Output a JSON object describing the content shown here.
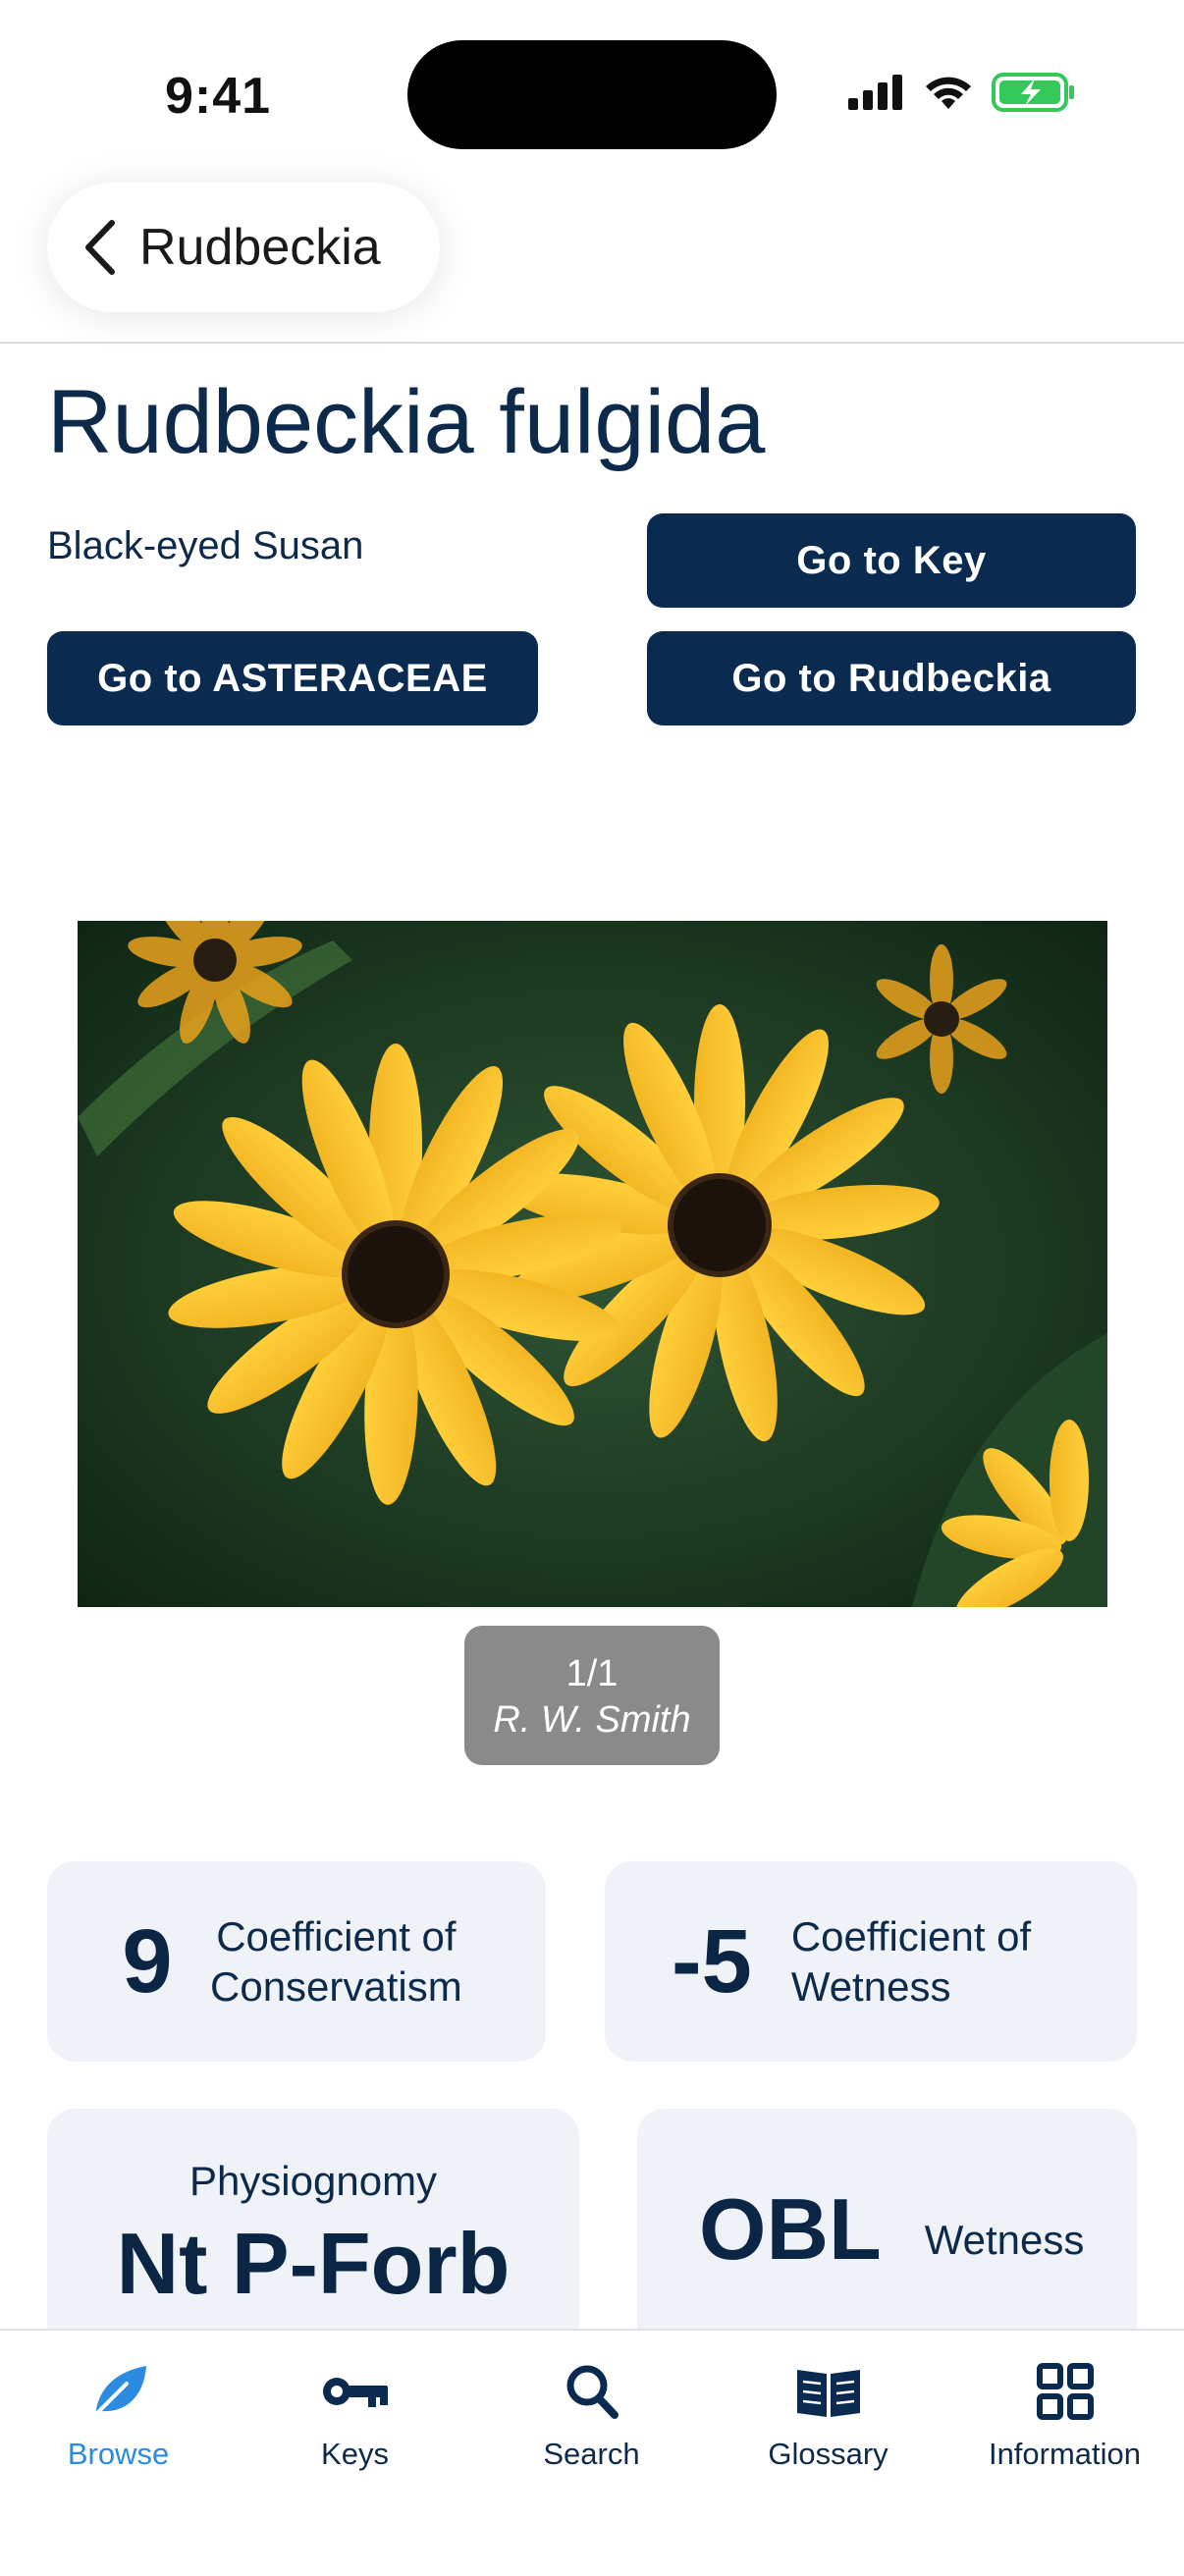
{
  "status": {
    "time": "9:41"
  },
  "header": {
    "back_label": "Rudbeckia"
  },
  "species": {
    "scientific_name": "Rudbeckia fulgida",
    "common_name": "Black-eyed Susan"
  },
  "buttons": {
    "key": "Go to Key",
    "family": "Go to ASTERACEAE",
    "genus": "Go to Rudbeckia"
  },
  "photo": {
    "counter": "1/1",
    "credit": "R. W. Smith"
  },
  "stats": {
    "cc": {
      "value": "9",
      "label_line1": "Coefficient of",
      "label_line2": "Conservatism"
    },
    "cw": {
      "value": "-5",
      "label_line1": "Coefficient of",
      "label_line2": "Wetness"
    },
    "physiognomy": {
      "label": "Physiognomy",
      "value": "Nt P-Forb"
    },
    "wetness": {
      "value": "OBL",
      "label": "Wetness"
    }
  },
  "tabbar": {
    "tabs": [
      {
        "label": "Browse",
        "icon": "leaf-icon",
        "active": true
      },
      {
        "label": "Keys",
        "icon": "key-icon",
        "active": false
      },
      {
        "label": "Search",
        "icon": "search-icon",
        "active": false
      },
      {
        "label": "Glossary",
        "icon": "book-icon",
        "active": false
      },
      {
        "label": "Information",
        "icon": "grid-icon",
        "active": false
      }
    ]
  },
  "colors": {
    "primary": "#0b2a4f",
    "active_tab": "#2a8be0",
    "card_bg": "#eff3f8",
    "caption_bg": "#8a8a8a",
    "battery": "#34c759"
  }
}
